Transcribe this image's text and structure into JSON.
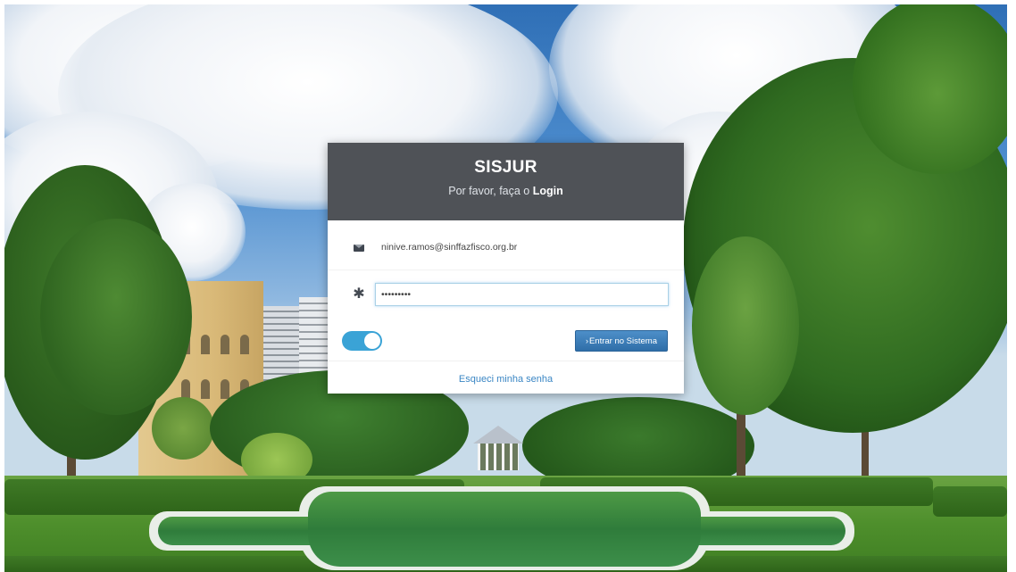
{
  "login": {
    "title": "SISJUR",
    "subtitle_prefix": "Por favor, faça o ",
    "subtitle_bold": "Login",
    "email": {
      "value": "ninive.ramos@sinffazfisco.org.br",
      "icon": "envelope-icon"
    },
    "password": {
      "value": "•••••••••",
      "icon": "asterisk-icon"
    },
    "remember_toggle": {
      "state": "on",
      "color": "#3aa3d6"
    },
    "submit_chevron": "›",
    "submit_label": "Entrar no Sistema",
    "forgot_label": "Esqueci minha senha"
  },
  "colors": {
    "header_background": "#2c3036",
    "primary_button": "#3a7bb8",
    "link": "#3a86c4"
  }
}
